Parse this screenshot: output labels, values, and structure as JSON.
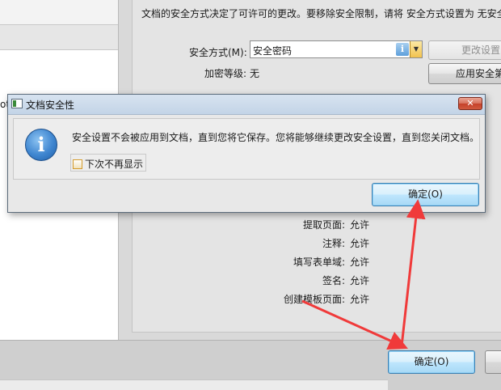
{
  "background": {
    "notice": "文档的安全方式决定了可许可的更改。要移除安全限制，请将 安全方式设置为 无安全",
    "security_method_label": "安全方式(M):",
    "security_method_value": "安全密码",
    "encryption_label": "加密等级:",
    "encryption_value": "无",
    "change_settings_button": "更改设置",
    "apply_security_button": "应用安全第",
    "clipped_char": "ot",
    "permissions": [
      {
        "label": "提取页面:",
        "value": "允许"
      },
      {
        "label": "注释:",
        "value": "允许"
      },
      {
        "label": "填写表单域:",
        "value": "允许"
      },
      {
        "label": "签名:",
        "value": "允许"
      },
      {
        "label": "创建模板页面:",
        "value": "允许"
      }
    ],
    "ok_button": "确定(O)"
  },
  "dialog": {
    "title": "文档安全性",
    "close_glyph": "✕",
    "icon_glyph": "i",
    "message": "安全设置不会被应用到文档，直到您将它保存。您将能够继续更改安全设置，直到您关闭文档。",
    "checkbox_label": "下次不再显示",
    "ok_button": "确定(O)"
  },
  "colors": {
    "annotation_arrow": "#f03a3a",
    "focus_border": "#3c7fb1"
  }
}
